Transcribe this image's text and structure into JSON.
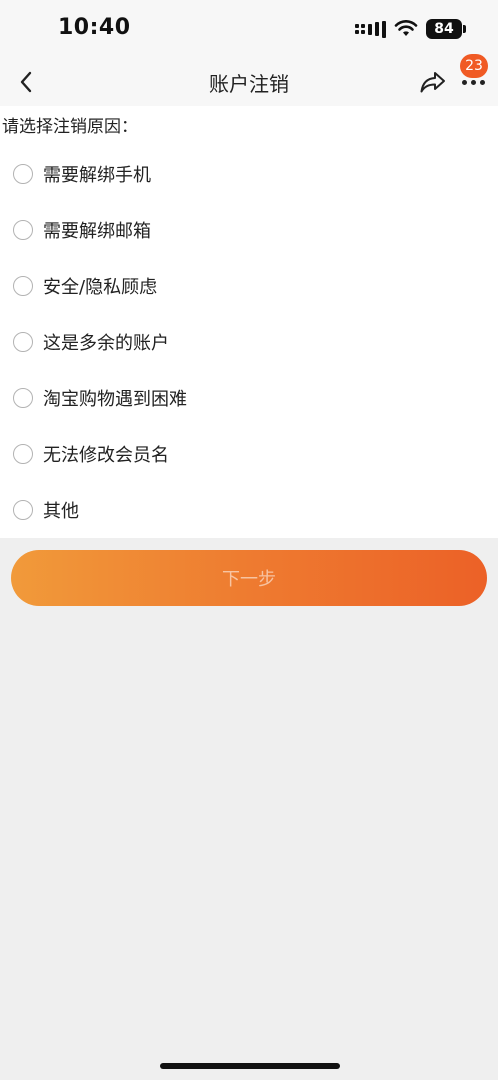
{
  "status_bar": {
    "time": "10:40",
    "battery": "84",
    "icons": [
      "cellular-signal-icon",
      "wifi-icon",
      "battery-icon"
    ]
  },
  "nav": {
    "title": "账户注销",
    "back_icon": "chevron-left-icon",
    "share_icon": "share-icon",
    "more_icon": "more-icon",
    "badge_count": "23",
    "badge_color": "#f05a24"
  },
  "form": {
    "prompt": "请选择注销原因：",
    "options": [
      "需要解绑手机",
      "需要解绑邮箱",
      "安全/隐私顾虑",
      "这是多余的账户",
      "淘宝购物遇到困难",
      "无法修改会员名",
      "其他"
    ]
  },
  "actions": {
    "next_label": "下一步",
    "gradient_start": "#f19a3a",
    "gradient_end": "#ec6127"
  }
}
